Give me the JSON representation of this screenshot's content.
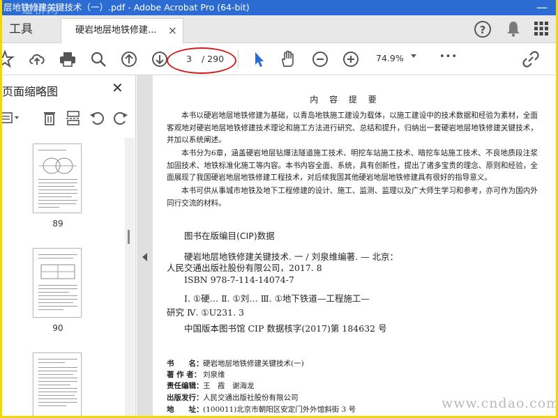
{
  "window": {
    "title": "层地铁修建关键技术（一）.pdf - Adobe Acrobat Pro (64-bit)",
    "watermark_top": "道桥网",
    "watermark_bottom": "www.cndao.com"
  },
  "tabs": {
    "tools_label": "工具",
    "doc_tab_label": "硬岩地层地铁修建...",
    "help_icon": "?"
  },
  "toolbar": {
    "page_current": "3",
    "page_total": "/ 290",
    "zoom": "74.9%",
    "more": "•••"
  },
  "thumbnails_panel": {
    "title": "页面缩略图",
    "pages": [
      {
        "number": "89"
      },
      {
        "number": "90"
      },
      {
        "number": ""
      }
    ]
  },
  "document": {
    "title": "内 容 提 要",
    "paragraphs": [
      "本书以硬岩地层地铁修建为基础，以青岛地铁施工建设为载体，以施工建设中的技术数据和经验为素材，全面客观地对硬岩地层地铁修建技术理论和施工方法进行研究、总结和提升，归纳出一套硬岩地层地铁修建关键技术，并加以系统阐述。",
      "本书分为6章，涵盖硬岩地层钻爆法隧道施工技术、明挖车站施工技术、暗挖车站施工技术、不良地质段注浆加固技术、地铁标准化施工等内容。本书内容全面、系统，具有创新性，提出了诸多宝贵的理念、原则和经验，全面展现了我国硬岩地层地铁修建工程技术，对后续我国其他硬岩地层地铁修建具有很好的指导意义。",
      "本书可供从事城市地铁及地下工程修建的设计、施工、监测、监理以及广大师生学习和参考，亦可作为国内外同行交流的材料。"
    ],
    "cip_heading": "图书在版编目(CIP)数据",
    "cip_lines": [
      "硬岩地层地铁修建关键技术. 一 / 刘泉维编著. — 北京：",
      "人民交通出版社股份有限公司，2017. 8",
      "ISBN  978-7-114-14074-7",
      "Ⅰ. ①硬…   Ⅱ. ①刘…   Ⅲ. ①地下铁道—工程施工—",
      "研究   Ⅳ. ①U231. 3",
      "中国版本图书馆 CIP 数据核字(2017)第 184632 号"
    ],
    "meta": [
      {
        "key": "书　　名：",
        "value": "硬岩地层地铁修建关键技术(一)"
      },
      {
        "key": "著 作 者：",
        "value": "刘泉维"
      },
      {
        "key": "责任编辑：",
        "value": "王　霞　谢海龙"
      },
      {
        "key": "出版发行：",
        "value": "人民交通出版社股份有限公司"
      },
      {
        "key": "地　　址：",
        "value": "(100011)北京市朝阳区安定门外外馆斜街 3 号"
      }
    ]
  }
}
